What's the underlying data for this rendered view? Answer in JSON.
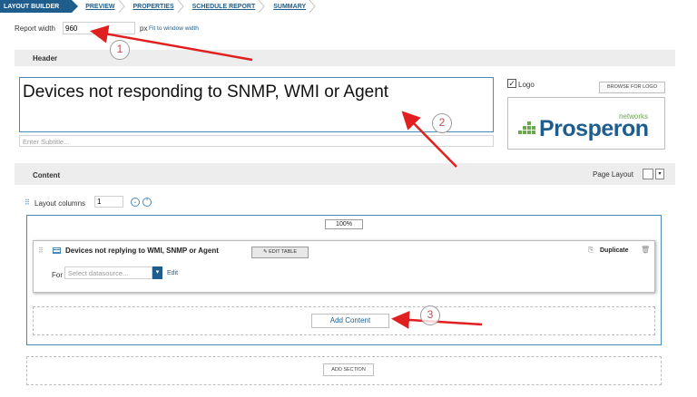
{
  "breadcrumb": {
    "items": [
      {
        "label": "LAYOUT BUILDER"
      },
      {
        "label": "PREVIEW"
      },
      {
        "label": "PROPERTIES"
      },
      {
        "label": "SCHEDULE REPORT"
      },
      {
        "label": "SUMMARY"
      }
    ]
  },
  "report_width": {
    "label": "Report width",
    "value": "960",
    "unit": "px",
    "fit_link": "Fit to window width"
  },
  "header": {
    "section_title": "Header",
    "title": "Devices not responding to SNMP, WMI or Agent",
    "subtitle_placeholder": "Enter Subtitle...",
    "logo_checked": true,
    "logo_label": "Logo",
    "browse_button": "BROWSE FOR LOGO",
    "logo": {
      "word": "Prosperon",
      "tag": "networks"
    }
  },
  "content": {
    "section_title": "Content",
    "page_layout_label": "Page Layout",
    "layout_columns_label": "Layout columns",
    "layout_columns_value": "1",
    "column_width": "100%",
    "panel": {
      "title": "Devices not replying to WMI, SNMP or Agent",
      "edit_table_button": "EDIT TABLE",
      "duplicate_label": "Duplicate",
      "for_label": "For",
      "datasource_placeholder": "Select datasource...",
      "edit_link": "Edit"
    },
    "add_content_button": "Add Content",
    "add_section_button": "ADD SECTION"
  },
  "annotations": [
    {
      "number": "1"
    },
    {
      "number": "2"
    },
    {
      "number": "3"
    }
  ],
  "colors": {
    "accent": "#1f5d8c",
    "border_blue": "#4a88b8",
    "arrow_red": "#e02020",
    "logo_green": "#6aa84f"
  }
}
